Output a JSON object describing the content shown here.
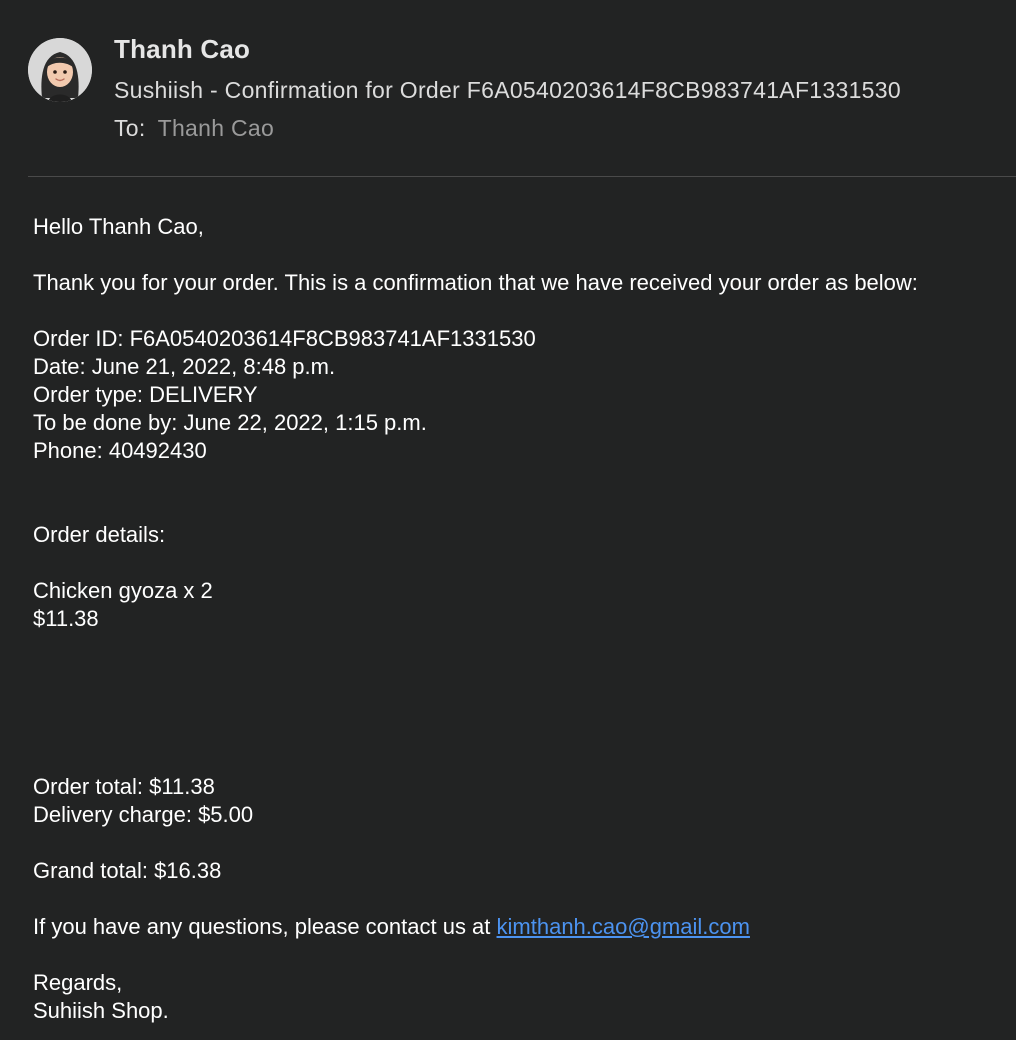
{
  "header": {
    "sender_name": "Thanh Cao",
    "subject": "Sushiish - Confirmation for Order F6A0540203614F8CB983741AF1331530",
    "to_label": "To:",
    "to_name": "Thanh Cao"
  },
  "body": {
    "greeting": "Hello Thanh Cao,",
    "intro": "Thank you for your order. This is a confirmation that we have received your order as below:",
    "order_id": "Order ID: F6A0540203614F8CB983741AF1331530",
    "date": "Date: June 21, 2022, 8:48 p.m.",
    "order_type": "Order type: DELIVERY",
    "done_by": "To be done by: June 22, 2022, 1:15 p.m.",
    "phone": "Phone: 40492430",
    "details_heading": "Order details:",
    "item_name": "Chicken gyoza x 2",
    "item_price": "$11.38",
    "order_total": "Order total: $11.38",
    "delivery_charge": "Delivery charge: $5.00",
    "grand_total": "Grand total: $16.38",
    "questions": "If you have any questions, please contact us at ",
    "contact_email": "kimthanh.cao@gmail.com",
    "regards": "Regards,",
    "signature": "Suhiish Shop."
  }
}
